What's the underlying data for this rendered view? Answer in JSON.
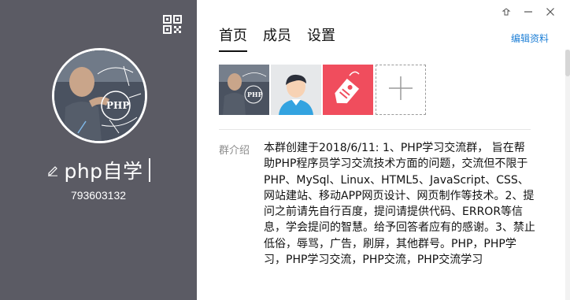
{
  "sidebar": {
    "group_name": "php自学",
    "group_id": "793603132",
    "avatar_icon": "php-hand-avatar",
    "qr_icon": "qr-code-icon",
    "edit_icon": "pencil-icon"
  },
  "window": {
    "controls": [
      "skin-icon",
      "minimize-icon",
      "close-icon"
    ]
  },
  "tabs": [
    {
      "label": "首页",
      "active": true
    },
    {
      "label": "成员",
      "active": false
    },
    {
      "label": "设置",
      "active": false
    }
  ],
  "edit_link": "编辑资料",
  "thumbnails": [
    {
      "icon": "php-photo-thumbnail"
    },
    {
      "icon": "user-avatar-thumbnail"
    },
    {
      "icon": "tag-thumbnail"
    }
  ],
  "add_icon": "plus-icon",
  "intro": {
    "label": "群介绍",
    "text": "本群创建于2018/6/11: 1、PHP学习交流群， 旨在帮助PHP程序员学习交流技术方面的问题，交流但不限于\nPHP、MySql、Linux、HTML5、JavaScript、CSS、网站建站、移动APP网页设计、网页制作等技术。2、提问之前请先自行百度，提问请提供代码、ERROR等信息，学会提问的智慧。给予回答者应有的感谢。3、禁止低俗，辱骂，广告，刷屏，其他群号。PHP，PHP学习，PHP学习交流，PHP交流，PHP交流学习"
  },
  "colors": {
    "sidebar_bg": "#5b5b64",
    "link": "#1e7fd6",
    "tag_red": "#f04d5d",
    "avatar_blue": "#33a3e0"
  }
}
